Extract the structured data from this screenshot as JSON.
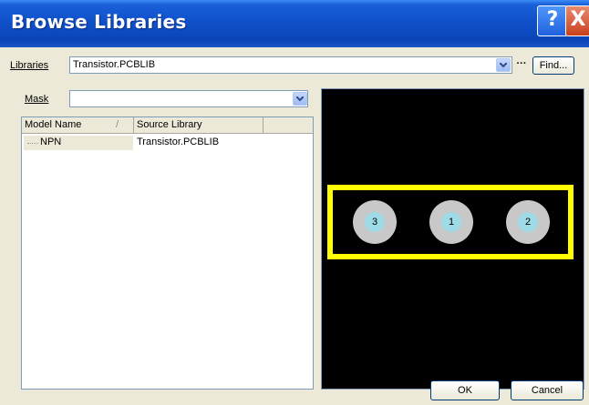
{
  "window": {
    "title": "Browse Libraries",
    "help_glyph": "?",
    "close_glyph": "X"
  },
  "libraries": {
    "label": "Libraries",
    "value": "Transistor.PCBLIB",
    "browse_label": "···",
    "find_label": "Find..."
  },
  "mask": {
    "label": "Mask",
    "value": ""
  },
  "table": {
    "columns": [
      "Model Name",
      "Source Library"
    ],
    "sort_indicator": "/",
    "rows": [
      {
        "model": "NPN",
        "source": "Transistor.PCBLIB"
      }
    ]
  },
  "preview": {
    "pads": [
      {
        "label": "3"
      },
      {
        "label": "1"
      },
      {
        "label": "2"
      }
    ],
    "outline_color": "#ffff00",
    "background": "#000000"
  },
  "buttons": {
    "ok": "OK",
    "cancel": "Cancel"
  }
}
